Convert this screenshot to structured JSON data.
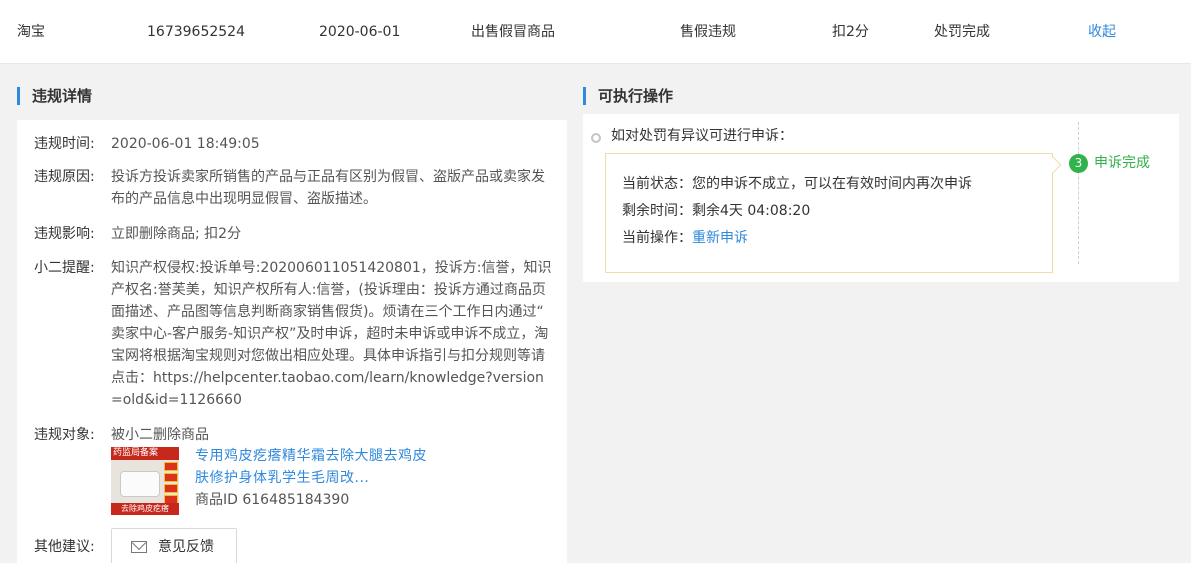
{
  "summary_row": {
    "platform": "淘宝",
    "order_id": "16739652524",
    "date": "2020-06-01",
    "violation_type": "出售假冒商品",
    "category": "售假违规",
    "penalty": "扣2分",
    "status": "处罚完成",
    "collapse_link": "收起"
  },
  "violation_details": {
    "title": "违规详情",
    "time_label": "违规时间:",
    "time_value": "2020-06-01 18:49:05",
    "reason_label": "违规原因:",
    "reason_value": "投诉方投诉卖家所销售的产品与正品有区别为假冒、盗版产品或卖家发布的产品信息中出现明显假冒、盗版描述。",
    "impact_label": "违规影响:",
    "impact_value": "立即删除商品; 扣2分",
    "reminder_label": "小二提醒:",
    "reminder_value": "知识产权侵权:投诉单号:202006011051420801，投诉方:信誉，知识产权名:誉芙美，知识产权所有人:信誉，(投诉理由：投诉方通过商品页面描述、产品图等信息判断商家销售假货)。烦请在三个工作日内通过“ 卖家中心-客户服务-知识产权”及时申诉，超时未申诉或申诉不成立，淘宝网将根据淘宝规则对您做出相应处理。具体申诉指引与扣分规则等请点击：https://helpcenter.taobao.com/learn/knowledge?version=old&id=1126660",
    "target_label": "违规对象:",
    "target_value": "被小二删除商品",
    "product": {
      "title": "专用鸡皮疙瘩精华霜去除大腿去鸡皮肤修护身体乳学生毛周改...",
      "id_text": "商品ID 616485184390",
      "thumb_banner": "药监局备案",
      "thumb_footer": "去除鸡皮疙瘩",
      "thumb_colors": {
        "band": "#c6281c",
        "tag": "#d9321f",
        "background": "#e8e3dc"
      }
    },
    "suggestion_label": "其他建议:",
    "feedback_button": "意见反馈"
  },
  "actions": {
    "title": "可执行操作",
    "appeal_prompt": "如对处罚有异议可进行申诉：",
    "step_number": "3",
    "step_label": "申诉完成",
    "status_label": "当前状态：",
    "status_value": "您的申诉不成立，可以在有效时间内再次申诉",
    "remaining_label": "剩余时间：",
    "remaining_value": "剩余4天 04:08:20",
    "operation_label": "当前操作：",
    "operation_link": "重新申诉"
  },
  "colors": {
    "accent": "#3089dc",
    "success": "#2fb34a",
    "box_border": "#f0dcab"
  },
  "icons": {
    "feedback_icon": "mail-icon",
    "bullet": "circle-dot-icon"
  }
}
